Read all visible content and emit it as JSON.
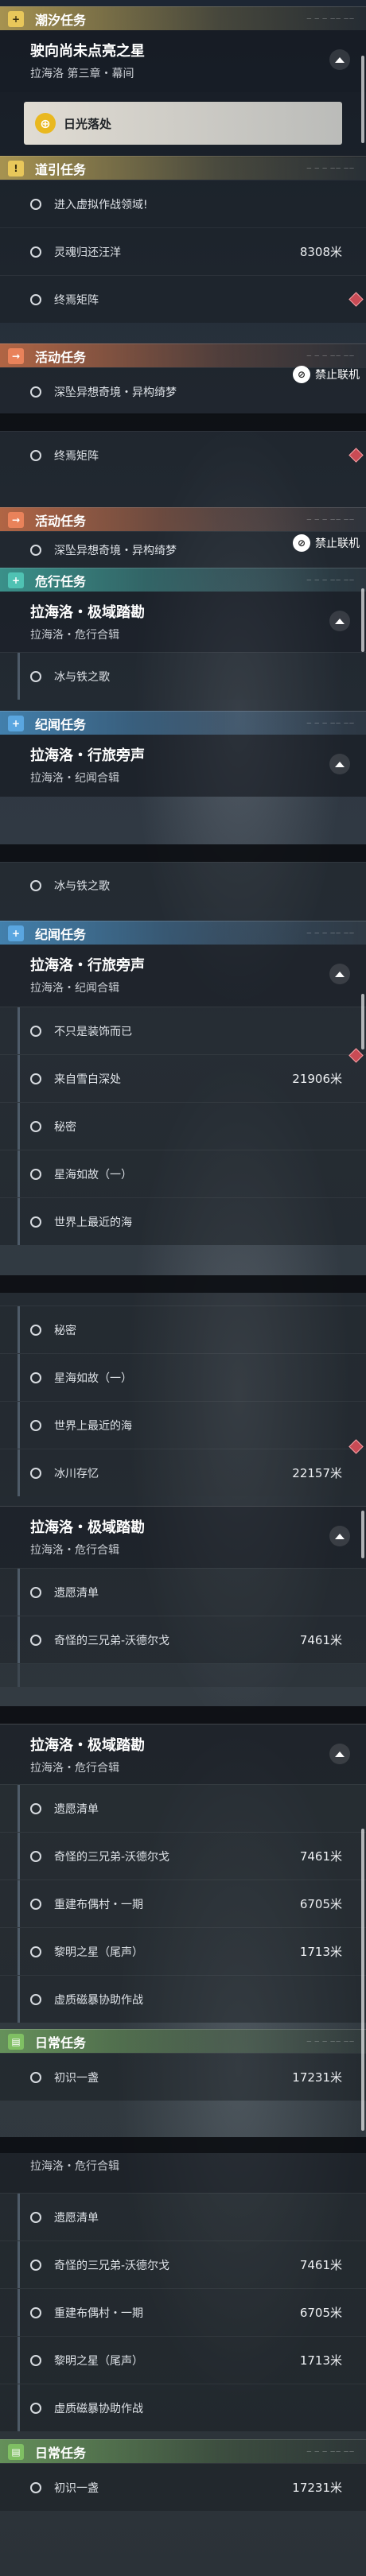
{
  "sections": {
    "chaoxi": {
      "title": "潮汐任务",
      "icon": "+"
    },
    "daoyin": {
      "title": "道引任务",
      "icon": "!"
    },
    "huodong": {
      "title": "活动任务",
      "icon": "→"
    },
    "weixing": {
      "title": "危行任务",
      "icon": "+"
    },
    "jiwen": {
      "title": "纪闻任务",
      "icon": "+"
    },
    "richang": {
      "title": "日常任务",
      "icon": "▤"
    }
  },
  "quests": {
    "q1": {
      "title": "驶向尚未点亮之星",
      "subtitle": "拉海洛 第三章・幕间",
      "item": "日光落处"
    },
    "daoyin_items": [
      "进入虚拟作战领域!",
      "灵魂归还汪洋",
      "终焉矩阵"
    ],
    "daoyin_dist": "8308米",
    "huodong_item": "深坠异想奇境・异构绮梦",
    "offline": "禁止联机",
    "jiyu": {
      "title": "拉海洛・极域踏勘",
      "subtitle": "拉海洛・危行合辑"
    },
    "xinglv": {
      "title": "拉海洛・行旅旁声",
      "subtitle": "拉海洛・纪闻合辑"
    },
    "bing": "冰与铁之歌",
    "xinglv_items": [
      "不只是装饰而已",
      "来自雪白深处",
      "秘密",
      "星海如故（一）",
      "世界上最近的海"
    ],
    "xinglv_dist": "21906米",
    "b4_items": [
      "秘密",
      "星海如故（一）",
      "世界上最近的海",
      "冰川存忆"
    ],
    "b4_dist": "22157米",
    "jiyu_items": [
      "遗愿清单",
      "奇怪的三兄弟-沃德尔戈",
      "重建布偶村・一期",
      "黎明之星（尾声）",
      "虚质磁暴协助作战"
    ],
    "jiyu_dists": [
      "7461米",
      "6705米",
      "1713米"
    ],
    "richang_item": "初识一盏",
    "richang_dist": "17231米"
  },
  "deco": "— — — —— ——"
}
